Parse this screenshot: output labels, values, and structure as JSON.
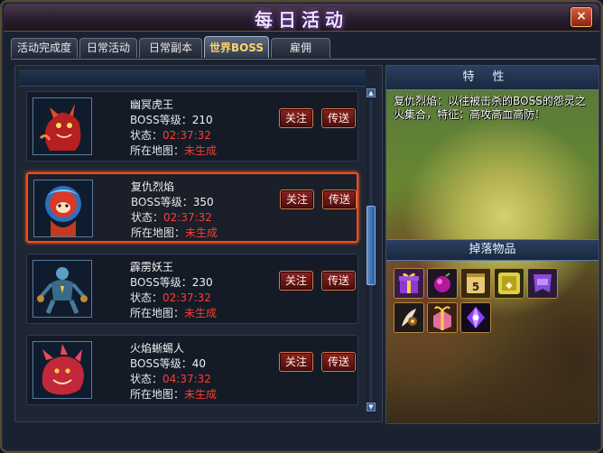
{
  "window": {
    "title": "每日活动",
    "close_label": "×"
  },
  "tabs": [
    {
      "label": "活动完成度",
      "active": false
    },
    {
      "label": "日常活动",
      "active": false
    },
    {
      "label": "日常副本",
      "active": false
    },
    {
      "label": "世界BOSS",
      "active": true
    },
    {
      "label": "雇佣",
      "active": false
    }
  ],
  "boss_list": {
    "level_label": "BOSS等级：",
    "status_label": "状态：",
    "map_label": "所在地图：",
    "follow_label": "关注",
    "teleport_label": "传送",
    "items": [
      {
        "name": "幽冥虎王",
        "level": "210",
        "status": "02:37:32",
        "map": "未生成",
        "portrait_icon": "red-tiger-beast-icon",
        "selected": false
      },
      {
        "name": "复仇烈焰",
        "level": "350",
        "status": "02:37:32",
        "map": "未生成",
        "portrait_icon": "flame-demon-icon",
        "selected": true
      },
      {
        "name": "霹雳妖王",
        "level": "230",
        "status": "02:37:32",
        "map": "未生成",
        "portrait_icon": "thunder-demon-icon",
        "selected": false
      },
      {
        "name": "火焰蜥蜴人",
        "level": "40",
        "status": "04:37:32",
        "map": "未生成",
        "portrait_icon": "fire-lizard-icon",
        "selected": false
      }
    ]
  },
  "detail": {
    "traits_title": "特性",
    "description": "复仇烈焰：以往被击杀的BOSS的怨灵之火集合，特征：高攻高血高防！",
    "drops_title": "掉落物品",
    "drops": [
      {
        "icon": "purple-gift-box-icon"
      },
      {
        "icon": "purple-orb-icon"
      },
      {
        "icon": "gold-scroll-5-icon"
      },
      {
        "icon": "gold-seal-icon"
      },
      {
        "icon": "purple-prestige-token-icon"
      },
      {
        "icon": "feather-amulet-icon"
      },
      {
        "icon": "pink-gift-box-icon"
      },
      {
        "icon": "purple-crystal-icon"
      }
    ]
  },
  "colors": {
    "accent_red": "#ff3c2a",
    "selection_border": "#ff4a16",
    "active_tab_text": "#ffd56a"
  }
}
